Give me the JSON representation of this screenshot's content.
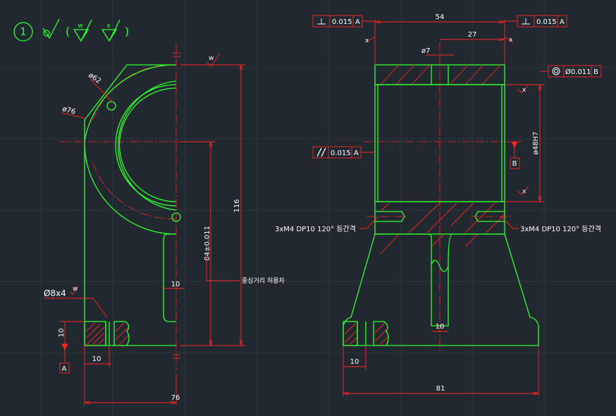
{
  "surface_finish": {
    "item_number": "1",
    "open_paren": "(",
    "close_paren": ")",
    "symbol_w": "w",
    "symbol_x": "x"
  },
  "left_view": {
    "dims": {
      "d62": "ø62",
      "d76": "ø76",
      "hole": "Ø8x4",
      "h116": "116",
      "h84": "84±0.011",
      "w10_mid": "10",
      "w10_bot": "10",
      "h10": "10",
      "w76": "76"
    },
    "center_tolerance_note": "중심거리 허용차",
    "datum_a": "A",
    "surface_marks": {
      "top": "w",
      "hole": "w"
    }
  },
  "right_view": {
    "dims": {
      "w54": "54",
      "w27": "27",
      "d7": "ø7",
      "bore": "ø48H7",
      "w10_mid": "10",
      "w10_left": "10",
      "w81": "81"
    },
    "thread_note_left": "3xM4  DP10  120° 등간격",
    "thread_note_right": "3xM4  DP10  120° 등간격",
    "datum_b": "B",
    "surface_marks": {
      "x": "x"
    },
    "gtol": {
      "perp_left": {
        "value": "0.015",
        "datum": "A"
      },
      "perp_right": {
        "value": "0.015",
        "datum": "A"
      },
      "parallel": {
        "value": "0.015",
        "datum": "A"
      },
      "concentric": {
        "value": "Ø0.011",
        "datum": "B"
      }
    }
  },
  "colors": {
    "background": "#212830",
    "object": "#2fff2f",
    "dimension": "#ff2424",
    "text": "#ffffff"
  }
}
